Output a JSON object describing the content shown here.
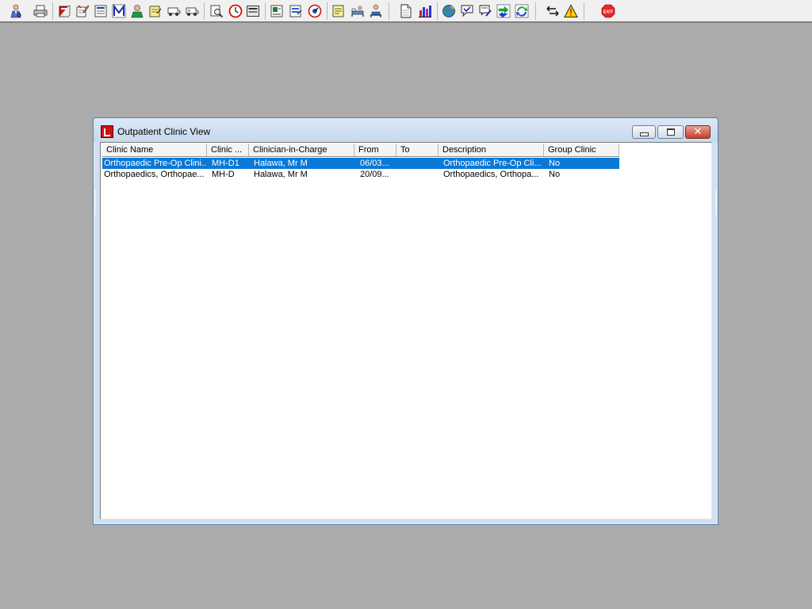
{
  "toolbar": {
    "buttons": [
      {
        "name": "clinician-icon"
      },
      {
        "name": "printer-icon"
      },
      {
        "name": "book-red-icon"
      },
      {
        "name": "notepad-pencil-icon"
      },
      {
        "name": "document-list-icon"
      },
      {
        "name": "m-letter-icon"
      },
      {
        "name": "person-green-icon"
      },
      {
        "name": "note-yellow-icon"
      },
      {
        "name": "vehicle-icon"
      },
      {
        "name": "vehicle-alt-icon"
      },
      {
        "name": "document-search-icon"
      },
      {
        "name": "clock-icon"
      },
      {
        "name": "panel-icon"
      },
      {
        "name": "image-doc-icon"
      },
      {
        "name": "form-edit-icon"
      },
      {
        "name": "gauge-icon"
      },
      {
        "name": "note-lines-icon"
      },
      {
        "name": "bed-icon"
      },
      {
        "name": "patient-bed-icon"
      },
      {
        "name": "page-icon"
      },
      {
        "name": "bar-chart-icon"
      },
      {
        "name": "globe-icon"
      },
      {
        "name": "comment-check-icon"
      },
      {
        "name": "comment-edit-icon"
      },
      {
        "name": "arrows-green-icon"
      },
      {
        "name": "arrows-refresh-icon"
      },
      {
        "name": "transfer-arrows-icon"
      },
      {
        "name": "warning-icon"
      },
      {
        "name": "exit-icon",
        "label": "EXIT"
      }
    ]
  },
  "window": {
    "title": "Outpatient Clinic View",
    "icon": "app-logo-icon"
  },
  "list": {
    "columns": [
      "Clinic Name",
      "Clinic ...",
      "Clinician-in-Charge",
      "From",
      "To",
      "Description",
      "Group Clinic"
    ],
    "rows": [
      {
        "selected": true,
        "cells": [
          "Orthopaedic Pre-Op Clini...",
          "MH-D1",
          "Halawa, Mr M",
          "06/03...",
          "",
          "Orthopaedic Pre-Op Cli...",
          "No"
        ]
      },
      {
        "selected": false,
        "cells": [
          "Orthopaedics, Orthopae...",
          "MH-D",
          "Halawa, Mr M",
          "20/09...",
          "",
          "Orthopaedics, Orthopa...",
          "No"
        ]
      }
    ]
  },
  "colors": {
    "desktop": "#ababab",
    "selection": "#0a78d7",
    "exit_red": "#e8262a"
  }
}
